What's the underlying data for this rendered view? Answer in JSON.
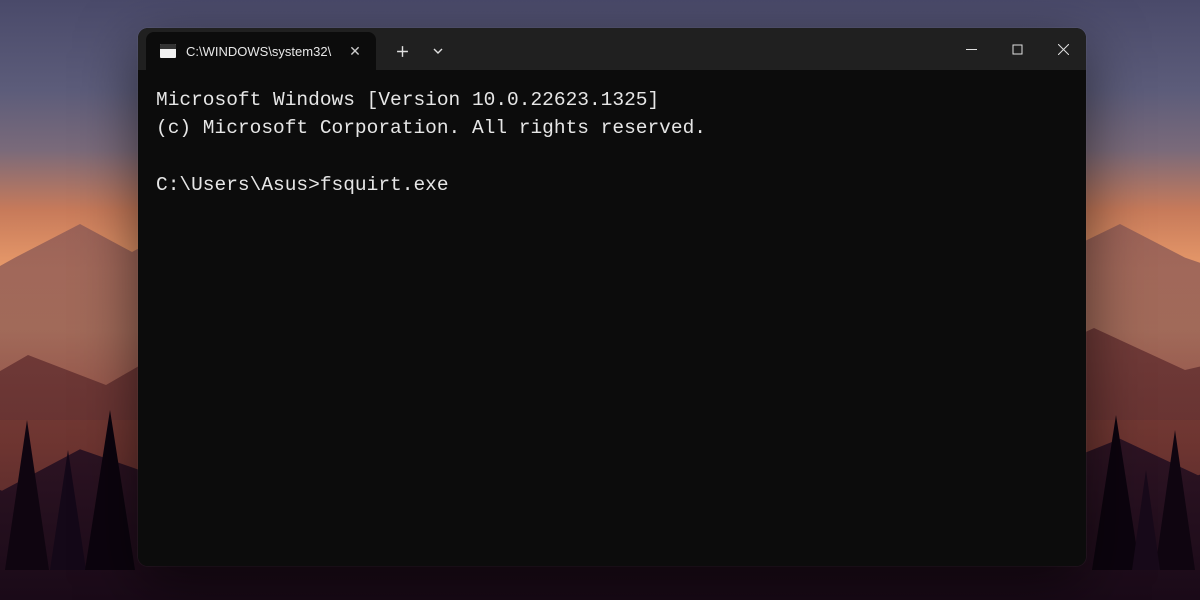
{
  "tab": {
    "title": "C:\\WINDOWS\\system32\\",
    "close_glyph": "✕"
  },
  "toolbar": {
    "new_tab_glyph": "＋",
    "dropdown_glyph": "﹀"
  },
  "terminal": {
    "line1": "Microsoft Windows [Version 10.0.22623.1325]",
    "line2": "(c) Microsoft Corporation. All rights reserved.",
    "blank": "",
    "prompt": "C:\\Users\\Asus>",
    "command": "fsquirt.exe"
  }
}
